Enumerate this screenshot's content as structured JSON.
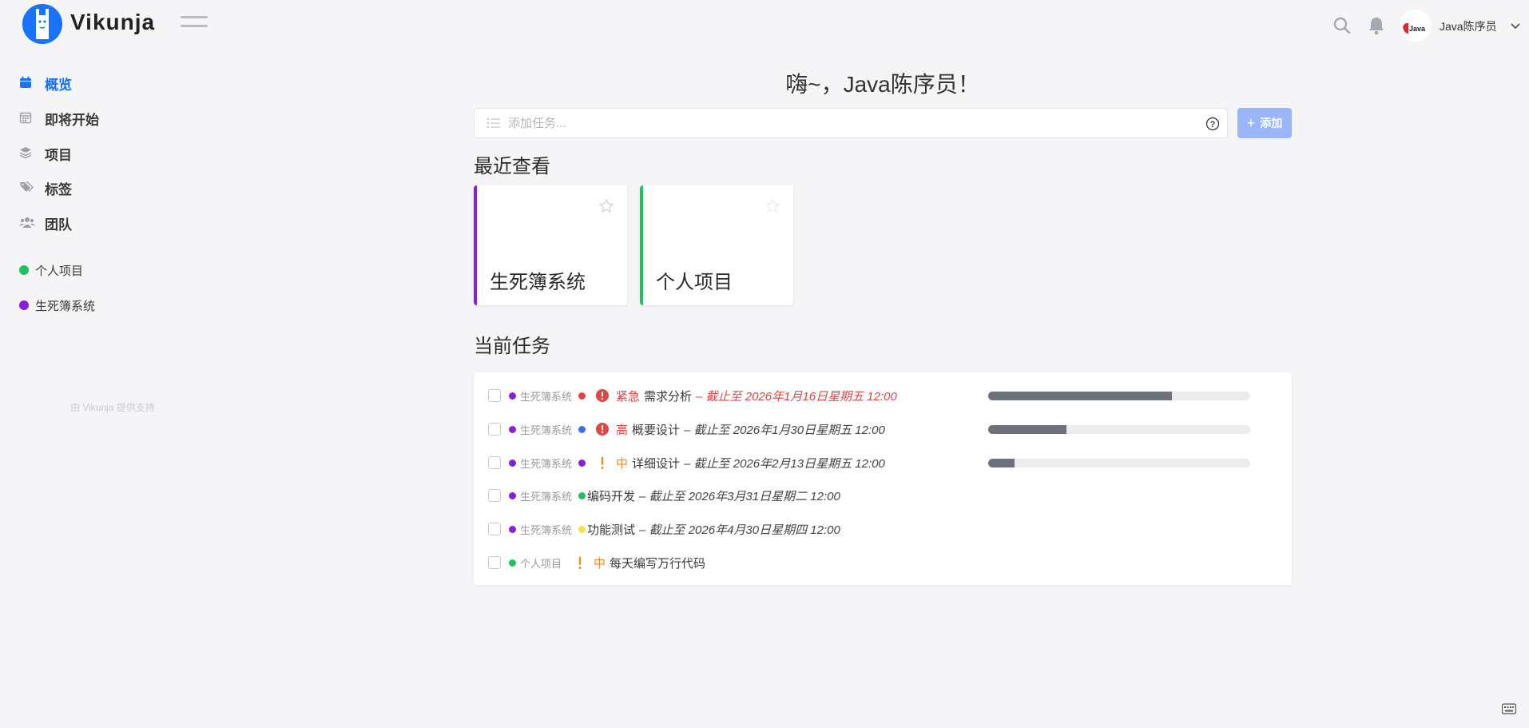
{
  "app": {
    "brand": "Vikunja",
    "accent": "#1973ff"
  },
  "header": {
    "user_name": "Java陈序员",
    "avatar_text": "Java"
  },
  "sidebar": {
    "nav": [
      {
        "label": "概览",
        "icon": "calendar-icon",
        "active": true
      },
      {
        "label": "即将开始",
        "icon": "calendar-grid-icon",
        "active": false
      },
      {
        "label": "项目",
        "icon": "layers-icon",
        "active": false
      },
      {
        "label": "标签",
        "icon": "tags-icon",
        "active": false
      },
      {
        "label": "团队",
        "icon": "users-icon",
        "active": false
      }
    ],
    "projects": [
      {
        "label": "个人项目",
        "color": "#1ec35d"
      },
      {
        "label": "生死簿系统",
        "color": "#8a1ee0"
      }
    ],
    "powered_by": "由 Vikunja 提供支持"
  },
  "main": {
    "greeting": "嗨~，Java陈序员！",
    "add_task": {
      "placeholder": "添加任务...",
      "button_label": "添加"
    },
    "recent_title": "最近查看",
    "recent_projects": [
      {
        "title": "生死簿系统",
        "color": "#8a1ee0"
      },
      {
        "title": "个人项目",
        "color": "#1ec35d"
      }
    ],
    "current_tasks_title": "当前任务",
    "tasks": [
      {
        "project": "生死簿系统",
        "project_color": "#8a1ee0",
        "label_color": "#e24545",
        "priority": "紧急",
        "priority_color": "#e24545",
        "priority_icon": "alert-circle-icon",
        "name": "需求分析",
        "due": "– 截止至 2026年1月16日星期五 12:00",
        "overdue": true,
        "progress": 0.7
      },
      {
        "project": "生死簿系统",
        "project_color": "#8a1ee0",
        "label_color": "#3b6ff0",
        "priority": "高",
        "priority_color": "#e24545",
        "priority_icon": "alert-circle-icon",
        "name": "概要设计",
        "due": "– 截止至 2026年1月30日星期五 12:00",
        "overdue": false,
        "progress": 0.3
      },
      {
        "project": "生死簿系统",
        "project_color": "#8a1ee0",
        "label_color": "#8a1ee0",
        "priority": "中",
        "priority_color": "#f08a24",
        "priority_icon": "exclamation-icon",
        "name": "详细设计",
        "due": "– 截止至 2026年2月13日星期五 12:00",
        "overdue": false,
        "progress": 0.1
      },
      {
        "project": "生死簿系统",
        "project_color": "#8a1ee0",
        "label_color": "#1ec35d",
        "priority": "",
        "priority_color": "",
        "priority_icon": "",
        "name": "编码开发",
        "due": "– 截止至 2026年3月31日星期二 12:00",
        "overdue": false,
        "progress": null
      },
      {
        "project": "生死簿系统",
        "project_color": "#8a1ee0",
        "label_color": "#f2e34a",
        "priority": "",
        "priority_color": "",
        "priority_icon": "",
        "name": "功能测试",
        "due": "– 截止至 2026年4月30日星期四 12:00",
        "overdue": false,
        "progress": null
      },
      {
        "project": "个人项目",
        "project_color": "#1ec35d",
        "label_color": "",
        "priority": "中",
        "priority_color": "#f08a24",
        "priority_icon": "exclamation-icon",
        "name": "每天编写万行代码",
        "due": "",
        "overdue": false,
        "progress": null
      }
    ]
  }
}
